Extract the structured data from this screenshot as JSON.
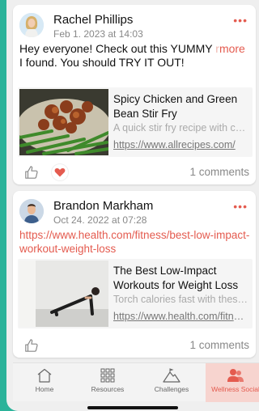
{
  "posts": [
    {
      "author": "Rachel Phillips",
      "date": "Feb 1, 2023 at 14:03",
      "text": "Hey everyone! Check out this YUMMY ",
      "text_fade": "r",
      "more_label": "more",
      "text2": "I found. You should TRY IT OUT!",
      "menu": "•••",
      "preview": {
        "title": "Spicy Chicken and Green Bean Stir Fry",
        "description": "A quick stir fry recipe with chicken and green beans",
        "url": "https://www.allrecipes.com/"
      },
      "comments": "1 comments",
      "liked": true
    },
    {
      "author": "Brandon Markham",
      "date": "Oct 24, 2022 at 07:28",
      "link": "https://www.health.com/fitness/best-low-impact-workout-weight-loss",
      "menu": "•••",
      "preview": {
        "title": "The Best Low-Impact Workouts for Weight Loss",
        "description": "Torch calories fast with these workouts",
        "url": "https://www.health.com/fitness"
      },
      "comments": "1 comments",
      "liked": false
    }
  ],
  "tabs": [
    {
      "label": "Home",
      "icon": "home-icon"
    },
    {
      "label": "Resources",
      "icon": "grid-icon"
    },
    {
      "label": "Challenges",
      "icon": "mountain-icon"
    },
    {
      "label": "Wellness Social",
      "icon": "people-icon",
      "active": true
    }
  ],
  "colors": {
    "accent": "#e45b4f",
    "background": "#2bb39a",
    "active_tab": "#f7d4cf"
  }
}
